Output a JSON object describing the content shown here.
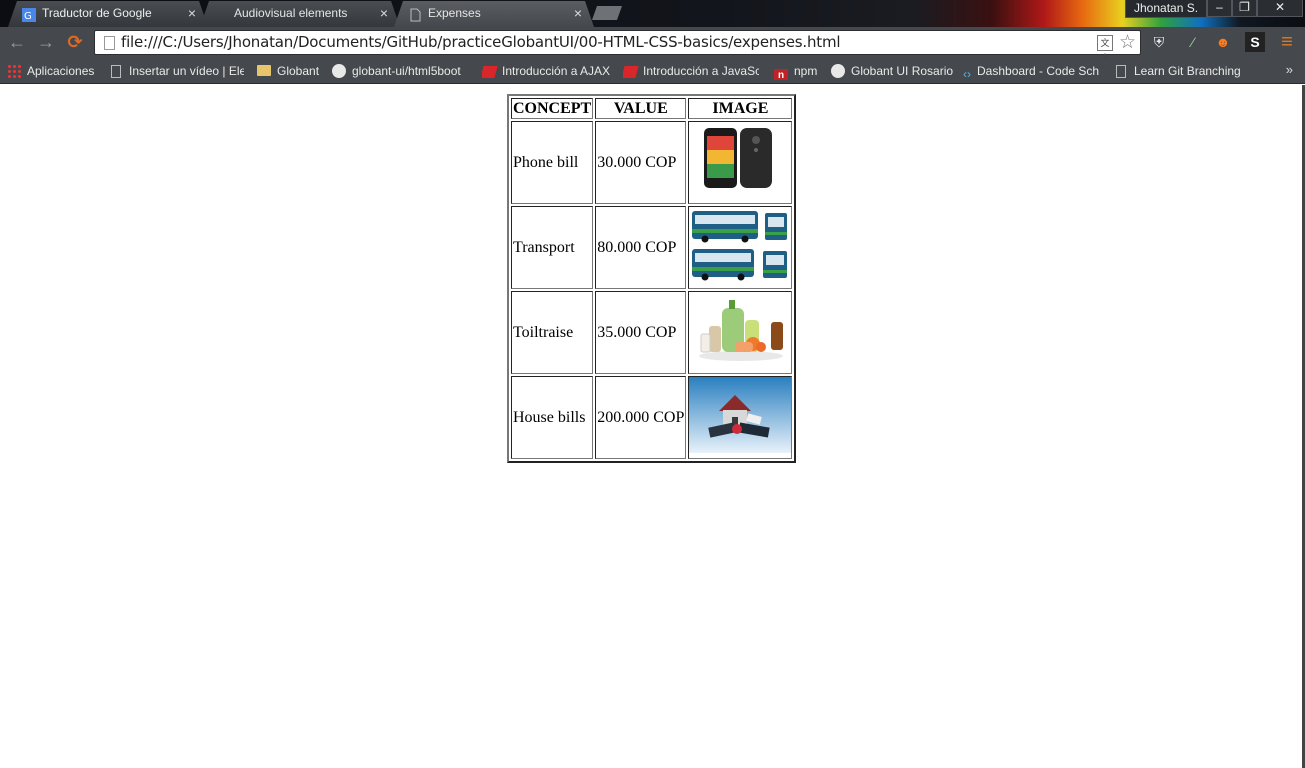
{
  "browser": {
    "tabs": [
      {
        "label": "Traductor de Google",
        "favicon": "google-translate-icon",
        "active": false
      },
      {
        "label": "Audiovisual elements",
        "favicon": "page-icon",
        "active": false
      },
      {
        "label": "Expenses",
        "favicon": "page-icon",
        "active": true
      }
    ],
    "close_glyph": "×",
    "user": "Jhonatan S.",
    "window_controls": {
      "minimize": "‒",
      "restore": "❐",
      "close": "✕"
    },
    "nav": {
      "back": "←",
      "forward": "→",
      "reload": "⟳"
    },
    "url": "file:///C:/Users/Jhonatan/Documents/GitHub/practiceGlobantUI/00-HTML-CSS-basics/expenses.html",
    "translate_glyph": "文A",
    "star_glyph": "☆",
    "extensions": {
      "shield": "⛨",
      "dropper": "⁄",
      "flame": "☻",
      "s_ext": "S",
      "menu": "≡"
    }
  },
  "bookmarks": {
    "items": [
      {
        "label": "Aplicaciones",
        "icon": "apps-icon"
      },
      {
        "label": "Insertar un vídeo | Eler",
        "icon": "page-icon"
      },
      {
        "label": "Globant",
        "icon": "folder-icon"
      },
      {
        "label": "globant-ui/html5boot",
        "icon": "github-icon"
      },
      {
        "label": "Introducción a AJAX",
        "icon": "codecademy-icon"
      },
      {
        "label": "Introducción a JavaSc",
        "icon": "codecademy-icon"
      },
      {
        "label": "npm",
        "icon": "npm-icon"
      },
      {
        "label": "Globant UI Rosario",
        "icon": "github-icon"
      },
      {
        "label": "Dashboard - Code Sch",
        "icon": "code-icon"
      },
      {
        "label": "Learn Git Branching",
        "icon": "page-icon"
      }
    ],
    "more": "»"
  },
  "table": {
    "headers": [
      "CONCEPT",
      "VALUE",
      "IMAGE"
    ],
    "rows": [
      {
        "concept": "Phone bill",
        "value": "30.000 COP",
        "image": "phone-image"
      },
      {
        "concept": "Transport",
        "value": "80.000 COP",
        "image": "bus-image"
      },
      {
        "concept": "Toiltraise",
        "value": "35.000 COP",
        "image": "toiletries-image"
      },
      {
        "concept": "House bills",
        "value": "200.000 COP",
        "image": "house-bills-image"
      }
    ]
  },
  "npm_glyph": "n",
  "code_glyph": "‹›",
  "colors": {
    "titlebar": "#0b0d12",
    "toolbar": "#45484c",
    "bus_blue": "#1f5f86",
    "bus_green": "#3aa047"
  }
}
